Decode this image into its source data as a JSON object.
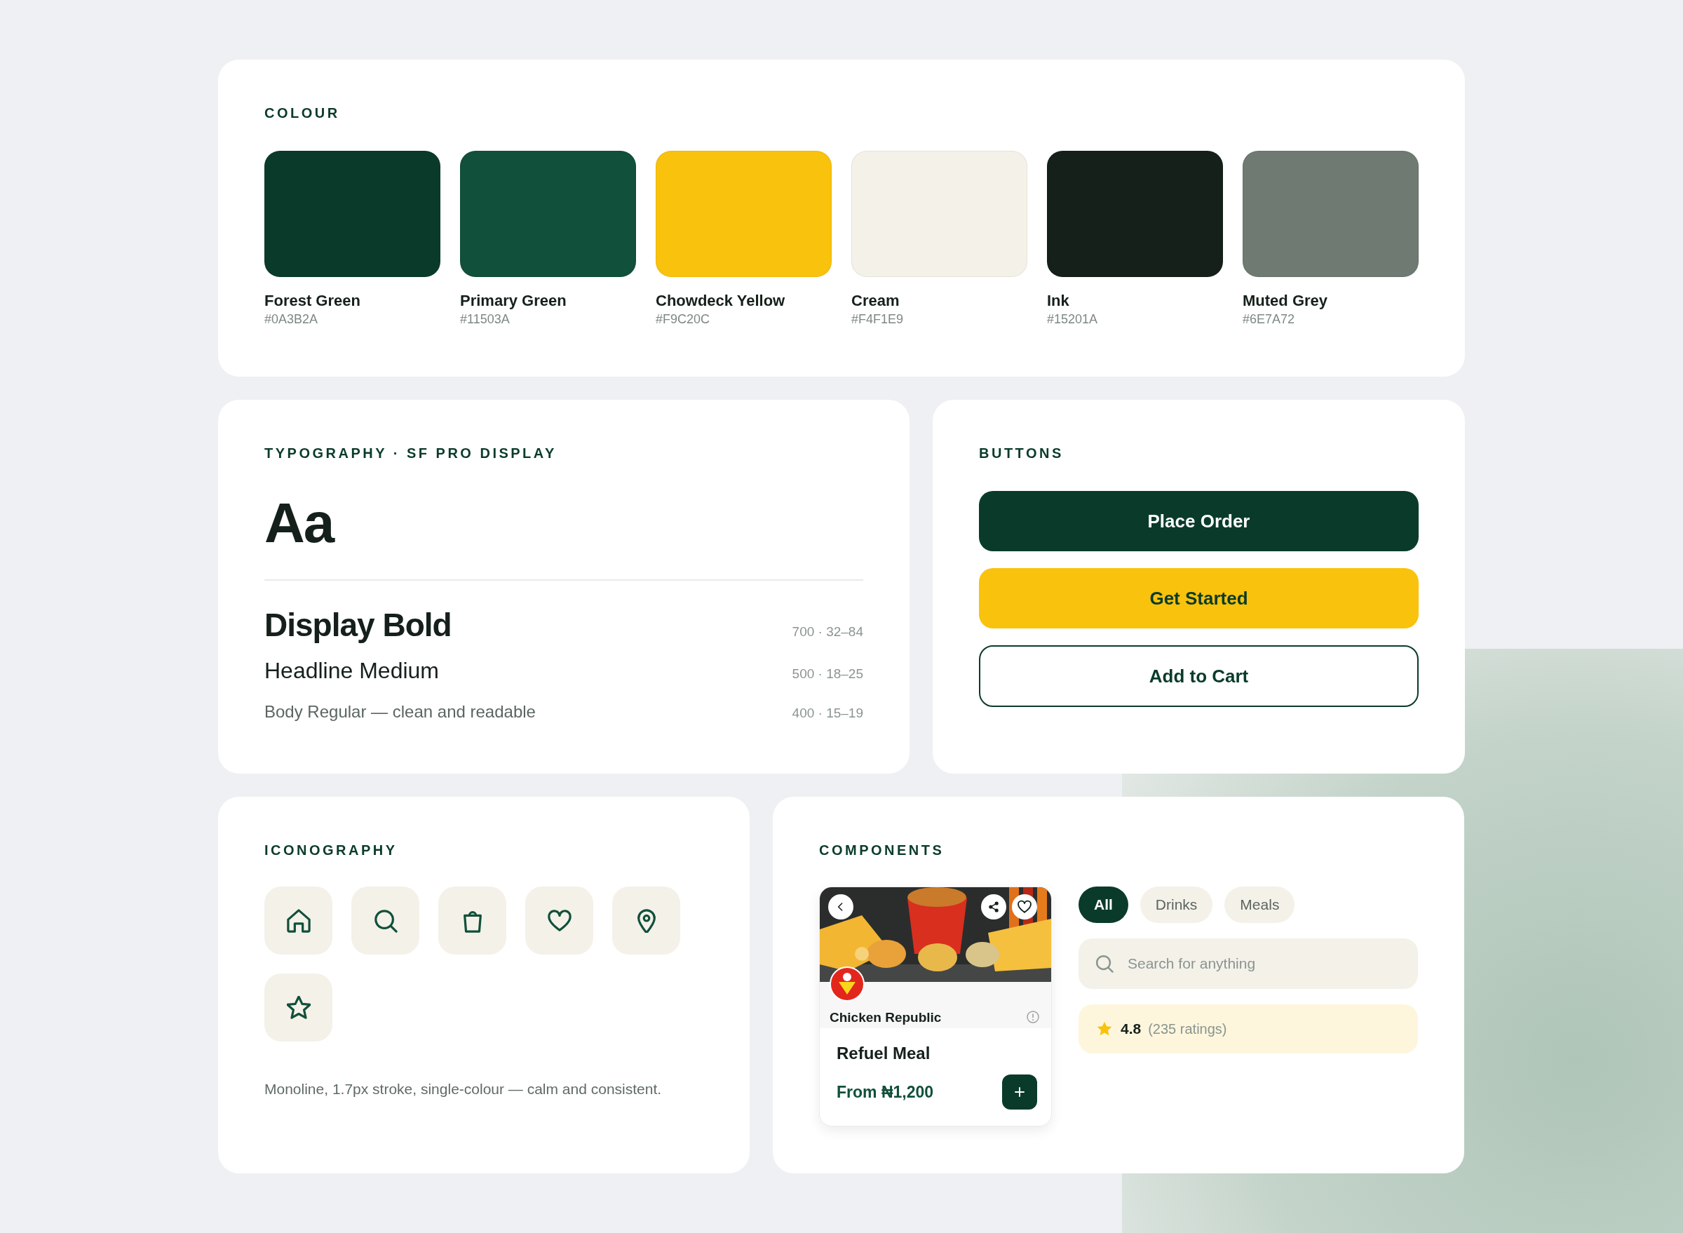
{
  "colour": {
    "title": "COLOUR",
    "swatches": [
      {
        "name": "Forest Green",
        "hex": "#0A3B2A",
        "color": "#0a3b2a"
      },
      {
        "name": "Primary Green",
        "hex": "#11503A",
        "color": "#11503a"
      },
      {
        "name": "Chowdeck Yellow",
        "hex": "#F9C20C",
        "color": "#f9c20c"
      },
      {
        "name": "Cream",
        "hex": "#F4F1E9",
        "color": "#f4f1e9"
      },
      {
        "name": "Ink",
        "hex": "#15201A",
        "color": "#15201a"
      },
      {
        "name": "Muted Grey",
        "hex": "#6E7A72",
        "color": "#6e7a72"
      }
    ]
  },
  "typography": {
    "title": "TYPOGRAPHY · SF PRO DISPLAY",
    "sample": "Aa",
    "styles": [
      {
        "kind": "display",
        "label": "Display Bold",
        "spec": "700 · 32–84"
      },
      {
        "kind": "headline",
        "label": "Headline Medium",
        "spec": "500 · 18–25"
      },
      {
        "kind": "body",
        "label": "Body Regular — clean and readable",
        "spec": "400 · 15–19"
      }
    ]
  },
  "buttons": {
    "title": "BUTTONS",
    "items": [
      {
        "kind": "primary",
        "label": "Place Order"
      },
      {
        "kind": "accent",
        "label": "Get Started"
      },
      {
        "kind": "outline",
        "label": "Add to Cart"
      }
    ]
  },
  "iconography": {
    "title": "ICONOGRAPHY",
    "icons": [
      {
        "kind": "home"
      },
      {
        "kind": "search"
      },
      {
        "kind": "bag"
      },
      {
        "kind": "heart"
      },
      {
        "kind": "pin"
      },
      {
        "kind": "star"
      }
    ],
    "caption": "Monoline, 1.7px stroke, single-colour — calm and consistent."
  },
  "components": {
    "title": "COMPONENTS",
    "product_card": {
      "brand": "Chicken Republic",
      "name": "Refuel Meal",
      "price": "From ₦1,200"
    },
    "chips": [
      {
        "label": "All",
        "selected": true
      },
      {
        "label": "Drinks",
        "selected": false
      },
      {
        "label": "Meals",
        "selected": false
      }
    ],
    "search": {
      "placeholder": "Search for anything"
    },
    "rating": {
      "score": "4.8",
      "count": "(235 ratings)"
    }
  }
}
